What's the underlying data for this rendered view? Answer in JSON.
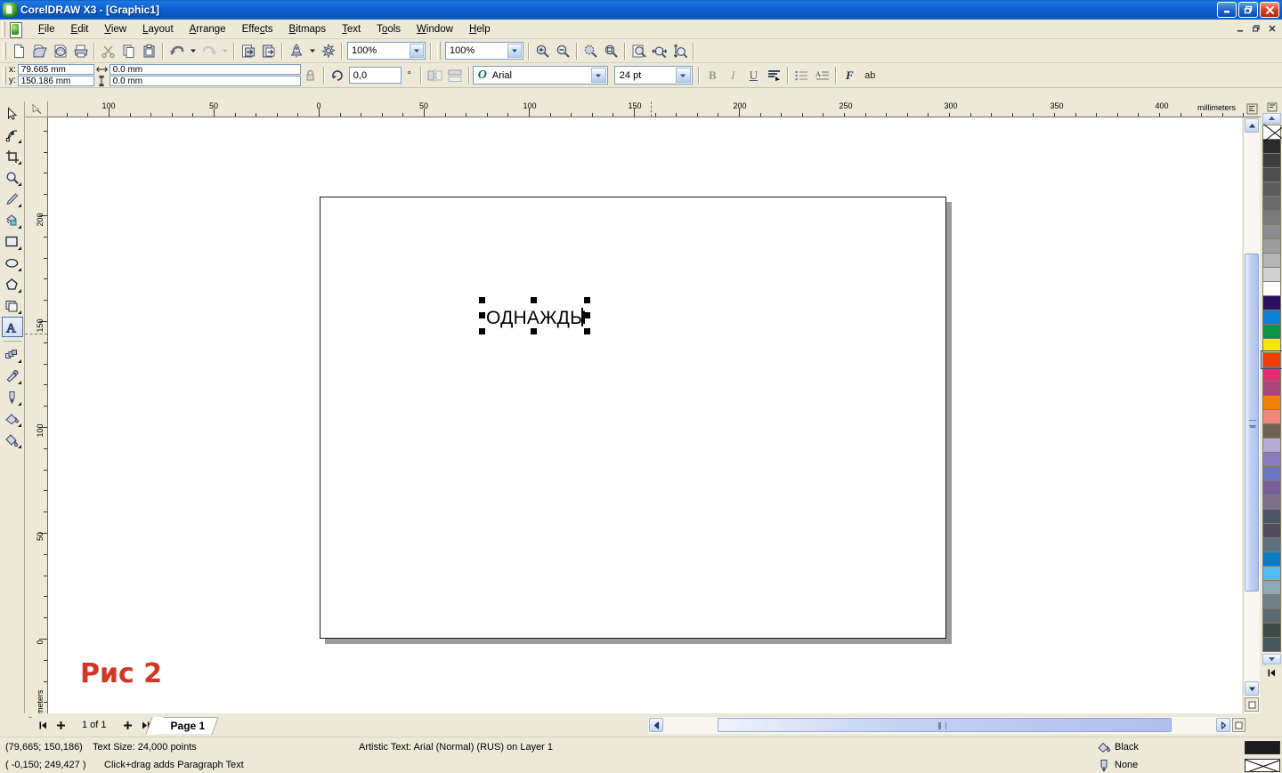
{
  "window": {
    "title": "CorelDRAW X3 - [Graphic1]",
    "app_icon": "coreldraw-balloon-icon",
    "buttons": {
      "minimize": "minimize-icon",
      "restore": "restore-icon",
      "close": "close-icon"
    },
    "mdi_buttons": {
      "minimize": "_",
      "restore": "❐",
      "close": "✕"
    }
  },
  "menu": {
    "items": [
      {
        "label": "File",
        "accel": "F"
      },
      {
        "label": "Edit",
        "accel": "E"
      },
      {
        "label": "View",
        "accel": "V"
      },
      {
        "label": "Layout",
        "accel": "L"
      },
      {
        "label": "Arrange",
        "accel": "A"
      },
      {
        "label": "Effects",
        "accel": "c"
      },
      {
        "label": "Bitmaps",
        "accel": "B"
      },
      {
        "label": "Text",
        "accel": "T"
      },
      {
        "label": "Tools",
        "accel": "o"
      },
      {
        "label": "Window",
        "accel": "W"
      },
      {
        "label": "Help",
        "accel": "H"
      }
    ]
  },
  "toolbar": {
    "buttons": [
      {
        "name": "new-document-button",
        "icon": "new-page-icon"
      },
      {
        "name": "open-document-button",
        "icon": "open-folder-icon"
      },
      {
        "name": "save-document-button",
        "icon": "save-disk-icon"
      },
      {
        "name": "print-button",
        "icon": "printer-icon"
      },
      {
        "name": "cut-button",
        "icon": "scissors-icon"
      },
      {
        "name": "copy-button",
        "icon": "copy-pages-icon"
      },
      {
        "name": "paste-button",
        "icon": "clipboard-icon"
      },
      {
        "name": "undo-button",
        "icon": "undo-arrow-icon"
      },
      {
        "name": "undo-dropdown",
        "icon": "chevron-down-icon"
      },
      {
        "name": "redo-button",
        "icon": "redo-arrow-icon"
      },
      {
        "name": "redo-dropdown",
        "icon": "chevron-down-icon"
      },
      {
        "name": "import-button",
        "icon": "import-icon"
      },
      {
        "name": "export-button",
        "icon": "export-icon"
      },
      {
        "name": "application-launcher-button",
        "icon": "rocket-icon"
      },
      {
        "name": "launcher-dropdown",
        "icon": "chevron-down-icon"
      },
      {
        "name": "corel-online-button",
        "icon": "globe-burst-icon"
      }
    ],
    "zoom_level": "100%",
    "zoom_level_2": "100%",
    "zoom_buttons": [
      {
        "name": "zoom-in-button",
        "icon": "magnifier-plus-icon"
      },
      {
        "name": "zoom-out-button",
        "icon": "magnifier-minus-icon"
      },
      {
        "name": "zoom-to-selection-button",
        "icon": "magnifier-selection-icon"
      },
      {
        "name": "zoom-to-all-objects-button",
        "icon": "magnifier-objects-icon"
      },
      {
        "name": "zoom-to-page-button",
        "icon": "magnifier-page-icon"
      },
      {
        "name": "zoom-to-page-width-button",
        "icon": "magnifier-page-width-icon"
      },
      {
        "name": "zoom-to-page-height-button",
        "icon": "magnifier-page-height-icon"
      }
    ]
  },
  "propertybar": {
    "x_label": "x:",
    "y_label": "y:",
    "x_value": "79.665 mm",
    "y_value": "150.186 mm",
    "width_value": "0.0 mm",
    "height_value": "0.0 mm",
    "lock_ratio_icon": "lock-icon",
    "rotation_value": "0,0",
    "rotation_unit": "°",
    "mirror_h_icon": "mirror-horizontal-icon",
    "mirror_v_icon": "mirror-vertical-icon",
    "font_name": "Arial",
    "font_size": "24 pt",
    "format_buttons": [
      {
        "name": "bold-button",
        "label": "B"
      },
      {
        "name": "italic-button",
        "label": "I"
      },
      {
        "name": "underline-button",
        "label": "U"
      },
      {
        "name": "text-alignment-button",
        "label": "align-icon"
      },
      {
        "name": "bullet-list-button",
        "label": "bullets-icon"
      },
      {
        "name": "drop-cap-button",
        "label": "dropcap-icon"
      },
      {
        "name": "character-formatting-button",
        "label": "F"
      },
      {
        "name": "edit-text-button",
        "label": "ab"
      }
    ]
  },
  "toolbox": {
    "tools": [
      {
        "name": "pick-tool",
        "icon": "arrow-cursor-icon",
        "flyout": false,
        "active": false
      },
      {
        "name": "shape-tool",
        "icon": "node-edit-icon",
        "flyout": true,
        "active": false
      },
      {
        "name": "crop-tool",
        "icon": "crop-icon",
        "flyout": true,
        "active": false
      },
      {
        "name": "zoom-tool",
        "icon": "magnifier-icon",
        "flyout": true,
        "active": false
      },
      {
        "name": "freehand-tool",
        "icon": "pen-freehand-icon",
        "flyout": true,
        "active": false
      },
      {
        "name": "smart-fill-tool",
        "icon": "paint-bucket-smart-icon",
        "flyout": true,
        "active": false
      },
      {
        "name": "rectangle-tool",
        "icon": "rectangle-icon",
        "flyout": true,
        "active": false
      },
      {
        "name": "ellipse-tool",
        "icon": "ellipse-icon",
        "flyout": true,
        "active": false
      },
      {
        "name": "polygon-tool",
        "icon": "polygon-icon",
        "flyout": true,
        "active": false
      },
      {
        "name": "basic-shapes-tool",
        "icon": "basic-shapes-icon",
        "flyout": true,
        "active": false
      },
      {
        "name": "text-tool",
        "icon": "text-a-icon",
        "flyout": false,
        "active": true
      },
      {
        "name": "interactive-blend-tool",
        "icon": "blend-icon",
        "flyout": true,
        "active": false
      },
      {
        "name": "eyedropper-tool",
        "icon": "eyedropper-icon",
        "flyout": true,
        "active": false
      },
      {
        "name": "outline-tool",
        "icon": "pen-nib-icon",
        "flyout": true,
        "active": false
      },
      {
        "name": "fill-tool",
        "icon": "fill-swatch-icon",
        "flyout": true,
        "active": false
      },
      {
        "name": "interactive-fill-tool",
        "icon": "paint-bucket-icon",
        "flyout": true,
        "active": false
      }
    ]
  },
  "rulers": {
    "unit_label": "millimeters",
    "horizontal_labels": [
      "100",
      "50",
      "0",
      "50",
      "100",
      "150",
      "200",
      "250",
      "300",
      "350",
      "400"
    ],
    "vertical_labels": [
      "200",
      "150",
      "100",
      "50",
      "0"
    ]
  },
  "document": {
    "text_object": "ОДНАЖДЫ",
    "annotation": "Рис 2",
    "annotation_color": "#cf3726"
  },
  "pagenav": {
    "first_page_icon": "first-page-icon",
    "add_page_before_icon": "plus-icon",
    "page_counter": "1 of 1",
    "add_page_after_icon": "plus-icon",
    "last_page_icon": "last-page-icon",
    "tab_label": "Page 1"
  },
  "statusbar": {
    "cursor_position": "(79,665; 150,186)",
    "text_size": "Text Size: 24,000 points",
    "object_info": "Artistic Text: Arial (Normal) (RUS) on Layer 1",
    "page_position": "( -0,150; 249,427 )",
    "hint": "Click+drag adds Paragraph Text",
    "fill_label": "Black",
    "fill_icon": "fill-bucket-icon",
    "fill_color": "#1c1c1c",
    "outline_label": "None",
    "outline_icon": "pen-nib-icon"
  },
  "palette": {
    "scroll_up_icon": "chevron-up-icon",
    "scroll_down_icon": "chevron-down-icon",
    "scroll_left_icon": "scroll-left-icon",
    "colors": [
      "none",
      "#2b2b2b",
      "#3d3d3d",
      "#4d4d4d",
      "#5c5c5c",
      "#6b6b6b",
      "#7b7b7b",
      "#8c8c8c",
      "#9e9e9e",
      "#b5b5b5",
      "#d2d2d2",
      "#ffffff",
      "#2b1060",
      "#0a7fd4",
      "#0a9448",
      "#f5e800",
      "#ee4000",
      "#ea2a72",
      "#a9457c",
      "#f08000",
      "#f5867c",
      "#6e6054",
      "#b8aad4",
      "#8b7cc0",
      "#6a76c0",
      "#7a5fa0",
      "#7f6f8e",
      "#4a5568",
      "#53495c",
      "#5f707e",
      "#0a7ac4",
      "#53bdf0",
      "#8fa8b8",
      "#6f8088",
      "#5a6a70",
      "#3c4a45",
      "#47565c"
    ],
    "selected_index": 16
  },
  "scrollbars": {
    "v_up_icon": "chevron-up-icon",
    "v_down_icon": "chevron-down-icon",
    "h_left_icon": "chevron-left-icon",
    "h_right_icon": "chevron-right-icon"
  }
}
